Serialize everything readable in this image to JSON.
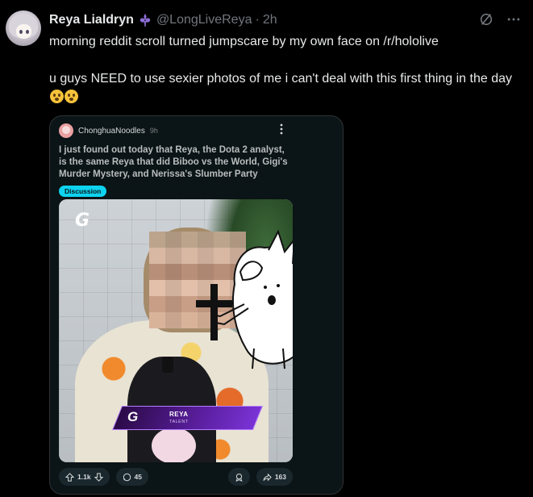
{
  "post": {
    "display_name": "Reya Lialdryn",
    "handle": "@LongLiveReya",
    "separator": "·",
    "time": "2h",
    "lines": [
      "morning reddit scroll turned jumpscare by my own face on /r/hololive",
      "u guys NEED to use sexier photos of me i can't deal with this first thing in the day"
    ]
  },
  "icons": {
    "badge": "fleur-de-lis-icon",
    "grok": "grok-icon",
    "more": "more-icon"
  },
  "reddit": {
    "username": "ChonghuaNoodles",
    "time": "9h",
    "title": "I just found out today that Reya, the Dota 2 analyst, is the same Reya that did Biboo vs the World, Gigi's Murder Mystery, and Nerissa's Slumber Party",
    "flair": "Discussion",
    "image": {
      "logo": "G",
      "lower_third_name": "REYA",
      "lower_third_role": "TALENT"
    },
    "actions": {
      "upvotes": "1.1k",
      "comments": "45",
      "shares": "163"
    }
  },
  "colors": {
    "background": "#000000",
    "text": "#e7e9ea",
    "muted": "#71767b",
    "badge": "#8f6fd8",
    "flair": "#0dd3f0",
    "reddit_bg": "#0b1416"
  }
}
